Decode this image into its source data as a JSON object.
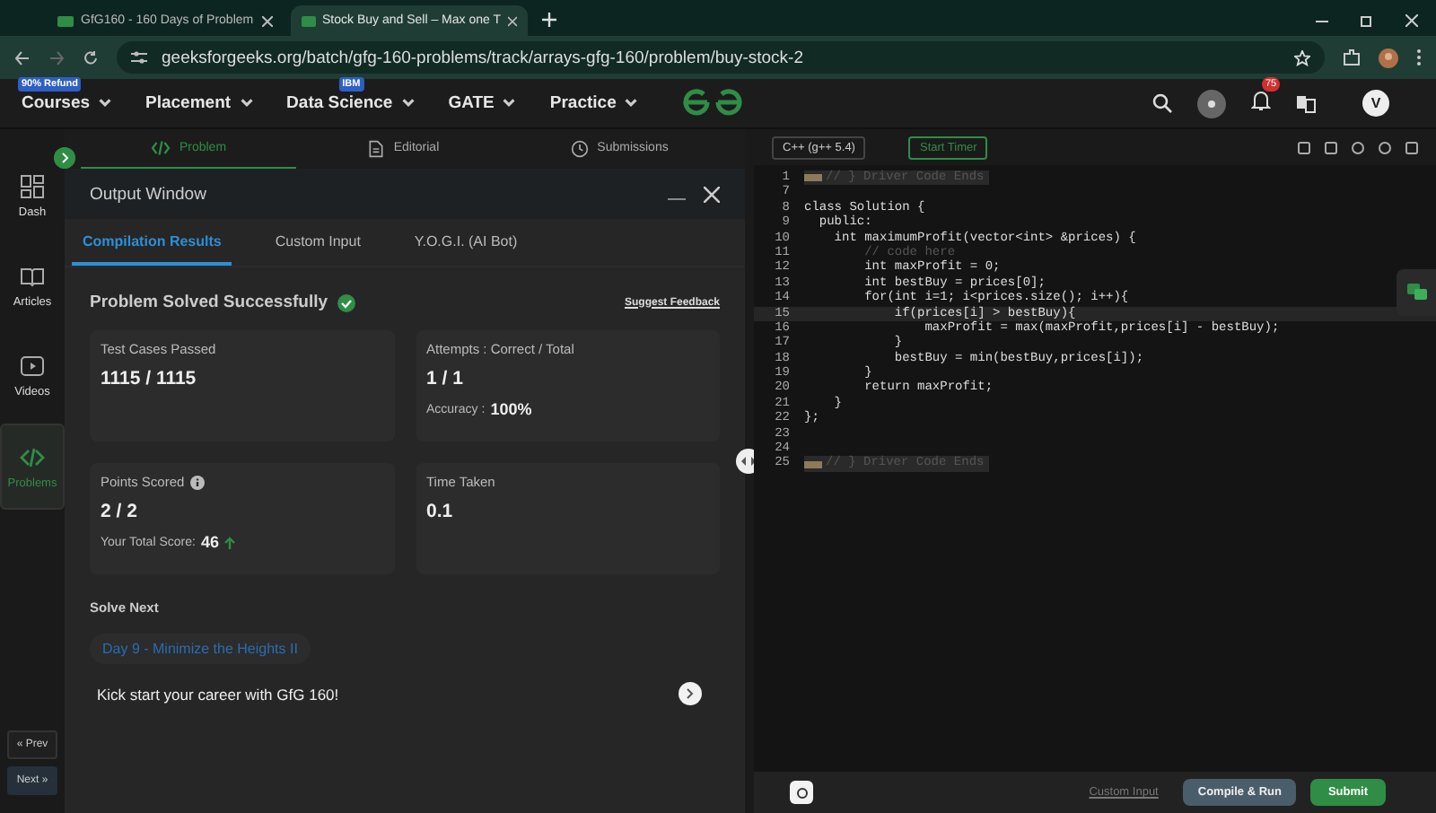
{
  "browser": {
    "tabs": [
      {
        "title": "GfG160 - 160 Days of Problem",
        "selected": false
      },
      {
        "title": "Stock Buy and Sell – Max one T",
        "selected": true
      }
    ],
    "url": "geeksforgeeks.org/batch/gfg-160-problems/track/arrays-gfg-160/problem/buy-stock-2"
  },
  "nav": {
    "items": [
      {
        "label": "Courses",
        "badge": "90% Refund"
      },
      {
        "label": "Placement"
      },
      {
        "label": "Data Science",
        "badge": "IBM"
      },
      {
        "label": "GATE"
      },
      {
        "label": "Practice"
      }
    ],
    "notifications": "75",
    "avatar": "V"
  },
  "sidebar": {
    "items": [
      {
        "label": "Dash",
        "kind": "dash",
        "selected": false
      },
      {
        "label": "Articles",
        "kind": "book",
        "selected": false
      },
      {
        "label": "Videos",
        "kind": "video",
        "selected": false
      },
      {
        "label": "Problems",
        "kind": "code",
        "selected": true
      }
    ],
    "prev": "« Prev",
    "next": "Next »"
  },
  "problem_tabs": [
    {
      "label": "Problem",
      "kind": "code",
      "selected": true
    },
    {
      "label": "Editorial",
      "kind": "doc",
      "selected": false
    },
    {
      "label": "Submissions",
      "kind": "clock",
      "selected": false
    }
  ],
  "output_window": {
    "title": "Output Window",
    "tabs": [
      {
        "label": "Compilation Results",
        "selected": true
      },
      {
        "label": "Custom Input",
        "selected": false
      },
      {
        "label": "Y.O.G.I. (AI Bot)",
        "selected": false
      }
    ],
    "status": "Problem Solved Successfully",
    "feedback": "Suggest Feedback",
    "cards": [
      {
        "label": "Test Cases Passed",
        "value": "1115 / 1115"
      },
      {
        "label": "Attempts : Correct / Total",
        "value": "1 / 1",
        "note_label": "Accuracy :",
        "note_value": "100%"
      },
      {
        "label": "Points Scored",
        "info": true,
        "value": "2 / 2",
        "note_label": "Your Total Score:",
        "note_value": "46",
        "kind": "score"
      },
      {
        "label": "Time Taken",
        "value": "0.1"
      }
    ],
    "solve_next": {
      "heading": "Solve Next",
      "chip": "Day 9 - Minimize the Heights II",
      "banner": "Kick start your career with GfG 160!"
    }
  },
  "editor": {
    "language": "C++ (g++ 5.4)",
    "timer": "Start Timer",
    "lines": [
      {
        "number": "1",
        "text": "// } Driver Code Ends",
        "kind": "folded",
        "active": false
      },
      {
        "number": "7",
        "kind": "code",
        "active": false
      },
      {
        "number": "8",
        "text": "class Solution {",
        "kind": "code",
        "active": false
      },
      {
        "number": "9",
        "text": "  public:",
        "kind": "code",
        "active": false
      },
      {
        "number": "10",
        "text": "    int maximumProfit(vector<int> &prices) {",
        "kind": "code",
        "active": false
      },
      {
        "number": "11",
        "text": "        // code here",
        "kind": "comment",
        "active": false
      },
      {
        "number": "12",
        "text": "        int maxProfit = 0;",
        "kind": "code",
        "active": false
      },
      {
        "number": "13",
        "text": "        int bestBuy = prices[0];",
        "kind": "code",
        "active": false
      },
      {
        "number": "14",
        "text": "        for(int i=1; i<prices.size(); i++){",
        "kind": "code",
        "active": false
      },
      {
        "number": "15",
        "text": "            if(prices[i] > bestBuy){",
        "kind": "code",
        "active": true
      },
      {
        "number": "16",
        "text": "                maxProfit = max(maxProfit,prices[i] - bestBuy);",
        "kind": "code",
        "active": false
      },
      {
        "number": "17",
        "text": "            }",
        "kind": "code",
        "active": false
      },
      {
        "number": "18",
        "text": "            bestBuy = min(bestBuy,prices[i]);",
        "kind": "code",
        "active": false
      },
      {
        "number": "19",
        "text": "        }",
        "kind": "code",
        "active": false
      },
      {
        "number": "20",
        "text": "        return maxProfit;",
        "kind": "code",
        "active": false
      },
      {
        "number": "21",
        "text": "    }",
        "kind": "code",
        "active": false
      },
      {
        "number": "22",
        "text": "};",
        "kind": "code",
        "active": false
      },
      {
        "number": "23",
        "kind": "code",
        "active": false
      },
      {
        "number": "24",
        "kind": "code",
        "active": false
      },
      {
        "number": "25",
        "text": "// } Driver Code Ends",
        "kind": "folded",
        "active": false
      }
    ],
    "custom_input": "Custom Input",
    "compile": "Compile & Run",
    "submit": "Submit"
  }
}
